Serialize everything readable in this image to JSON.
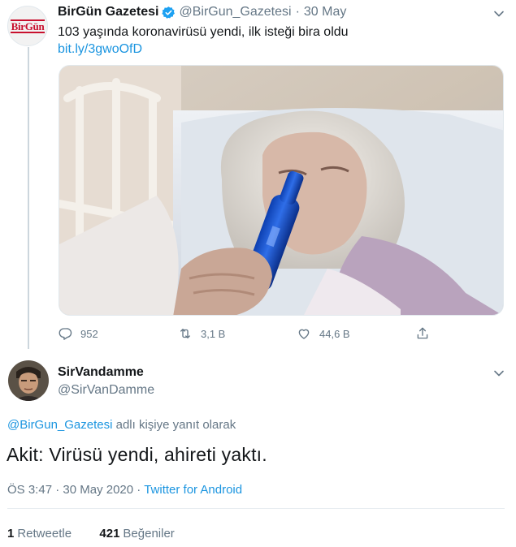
{
  "tweet1": {
    "display_name": "BirGün Gazetesi",
    "handle": "@BirGun_Gazetesi",
    "separator": "·",
    "date": "30 May",
    "logo_text": "BirGün",
    "text": "103 yaşında koronavirüsü yendi, ilk isteği bira oldu",
    "link": "bit.ly/3gwoOfD",
    "actions": {
      "reply_count": "952",
      "retweet_count": "3,1 B",
      "like_count": "44,6 B"
    },
    "icons": [
      "verified-badge-icon",
      "chevron-down-icon",
      "reply-icon",
      "retweet-icon",
      "heart-icon",
      "share-icon"
    ],
    "colors": {
      "link": "#1b95e0",
      "muted": "#657786",
      "verified": "#1da1f2",
      "logo": "#c8102e"
    }
  },
  "tweet2": {
    "display_name": "SirVandamme",
    "handle": "@SirVanDamme",
    "reply_mention": "@BirGun_Gazetesi",
    "reply_suffix": "adlı kişiye yanıt olarak",
    "text": "Akit: Virüsü yendi, ahireti yaktı.",
    "time": "ÖS 3:47",
    "date": "30 May 2020",
    "separator": "·",
    "source": "Twitter for Android",
    "retweets_count": "1",
    "retweets_label": "Retweetle",
    "likes_count": "421",
    "likes_label": "Beğeniler"
  }
}
